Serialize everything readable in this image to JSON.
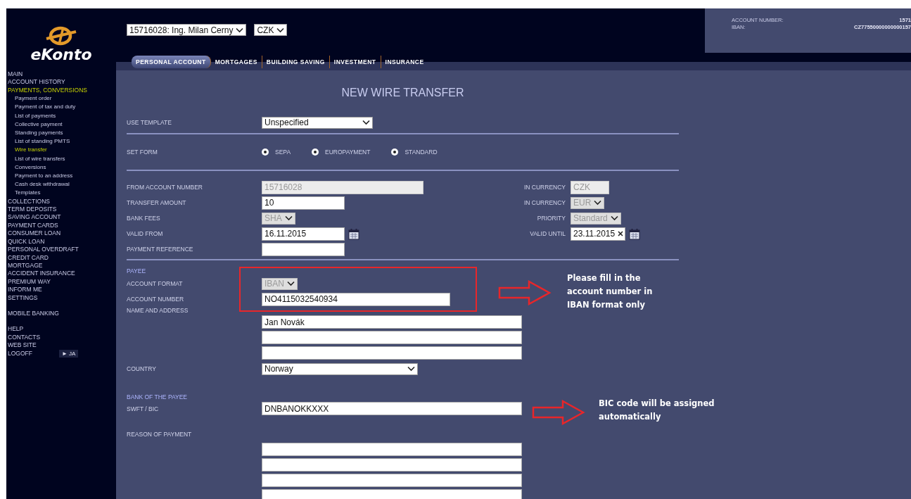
{
  "account_select": {
    "value": "15716028: Ing. Milan Cerny"
  },
  "currency_select": {
    "value": "CZK"
  },
  "account_info": [
    {
      "label": "ACCOUNT NUMBER:",
      "value": "1571"
    },
    {
      "label": "IBAN:",
      "value": "CZ77550000000000157"
    }
  ],
  "tabs": [
    {
      "label": "PERSONAL ACCOUNT",
      "selected": true
    },
    {
      "label": "MORTGAGES",
      "selected": false
    },
    {
      "label": "BUILDING SAVING",
      "selected": false
    },
    {
      "label": "INVESTMENT",
      "selected": false
    },
    {
      "label": "INSURANCE",
      "selected": false
    }
  ],
  "sidebar": {
    "logo": "eKonto",
    "language_button": "► JA",
    "groups": [
      [
        {
          "label": "MAIN",
          "selected": false
        },
        {
          "label": "ACCOUNT HISTORY",
          "selected": false
        },
        {
          "label": "PAYMENTS, CONVERSIONS",
          "selected": true,
          "children": [
            {
              "label": "Payment order",
              "selected": false
            },
            {
              "label": "Payment of tax and duty",
              "selected": false
            },
            {
              "label": "List of payments",
              "selected": false
            },
            {
              "label": "Collective payment",
              "selected": false
            },
            {
              "label": "Standing payments",
              "selected": false
            },
            {
              "label": "List of standing PMTS",
              "selected": false
            },
            {
              "label": "Wire transfer",
              "selected": true
            },
            {
              "label": "List of wire transfers",
              "selected": false
            },
            {
              "label": "Conversions",
              "selected": false
            },
            {
              "label": "Payment to an address",
              "selected": false
            },
            {
              "label": "Cash desk withdrawal",
              "selected": false
            },
            {
              "label": "Templates",
              "selected": false
            }
          ]
        },
        {
          "label": "COLLECTIONS",
          "selected": false
        },
        {
          "label": "TERM DEPOSITS",
          "selected": false
        },
        {
          "label": "SAVING ACCOUNT",
          "selected": false
        },
        {
          "label": "PAYMENT CARDS",
          "selected": false
        },
        {
          "label": "CONSUMER LOAN",
          "selected": false
        },
        {
          "label": "QUICK LOAN",
          "selected": false
        },
        {
          "label": "PERSONAL OVERDRAFT",
          "selected": false
        },
        {
          "label": "CREDIT CARD",
          "selected": false
        },
        {
          "label": "MORTGAGE",
          "selected": false
        },
        {
          "label": "ACCIDENT INSURANCE",
          "selected": false
        },
        {
          "label": "PREMIUM WAY",
          "selected": false
        },
        {
          "label": "INFORM ME",
          "selected": false
        },
        {
          "label": "SETTINGS",
          "selected": false
        }
      ],
      [
        {
          "label": "MOBILE BANKING",
          "selected": false
        }
      ],
      [
        {
          "label": "HELP",
          "selected": false
        },
        {
          "label": "CONTACTS",
          "selected": false
        },
        {
          "label": "WEB SITE",
          "selected": false
        },
        {
          "label": "LOGOFF",
          "selected": false
        }
      ]
    ]
  },
  "form": {
    "title": "NEW WIRE TRANSFER",
    "template": {
      "label": "USE TEMPLATE",
      "kind": "dropdown",
      "value": "Unspecified",
      "disabled": false
    },
    "set_form": {
      "label": "SET FORM",
      "options": [
        {
          "label": "SEPA",
          "selected": true
        },
        {
          "label": "EUROPAYMENT",
          "selected": true
        },
        {
          "label": "STANDARD",
          "selected": true
        }
      ]
    },
    "details": {
      "left": [
        {
          "label": "FROM ACCOUNT NUMBER",
          "kind": "wide",
          "value": "15716028",
          "disabled": true
        },
        {
          "label": "TRANSFER AMOUNT",
          "kind": "text",
          "value": "10",
          "disabled": false
        },
        {
          "label": "BANK FEES",
          "kind": "select",
          "value": "SHA",
          "disabled": true
        },
        {
          "label": "VALID FROM",
          "kind": "date",
          "value": "16.11.2015",
          "clearable": false
        },
        {
          "label": "PAYMENT REFERENCE",
          "kind": "text",
          "disabled": false
        }
      ],
      "right": [
        {
          "label": "IN CURRENCY",
          "kind": "short",
          "value": "CZK",
          "disabled": true
        },
        {
          "label": "IN CURRENCY",
          "kind": "select",
          "value": "EUR",
          "disabled": true
        },
        {
          "label": "PRIORITY",
          "kind": "select",
          "value": "Standard",
          "disabled": true
        },
        {
          "label": "VALID UNTIL",
          "kind": "date",
          "value": "23.11.2015",
          "clearable": true
        }
      ]
    },
    "payee": {
      "heading": "PAYEE",
      "rows": [
        {
          "label": "ACCOUNT FORMAT",
          "kind": "select",
          "value": "IBAN",
          "disabled": true
        },
        {
          "label": "ACCOUNT NUMBER",
          "kind": "long",
          "value": "NO4115032540934",
          "disabled": false
        },
        {
          "label": "NAME AND ADDRESS",
          "kind": "lines",
          "lines": [
            {
              "kind": "text",
              "value": "Jan Novák"
            },
            {
              "kind": "text"
            },
            {
              "kind": "text"
            }
          ]
        },
        {
          "label": "COUNTRY",
          "kind": "country",
          "value": "Norway",
          "disabled": false
        }
      ]
    },
    "bank": {
      "heading": "BANK OF THE PAYEE",
      "rows": [
        {
          "label": "SWFT / BIC",
          "kind": "lines",
          "lines": [
            {
              "kind": "text",
              "value": "DNBANOKKXXX"
            }
          ]
        }
      ]
    },
    "reason": {
      "label": "REASON OF PAYMENT",
      "lines": [
        {
          "kind": "text"
        },
        {
          "kind": "text"
        },
        {
          "kind": "text"
        },
        {
          "kind": "text"
        }
      ]
    },
    "annotations": [
      {
        "text": "Please fill in the account number in IBAN format only"
      },
      {
        "text": "BIC code will be assigned automatically"
      }
    ]
  }
}
